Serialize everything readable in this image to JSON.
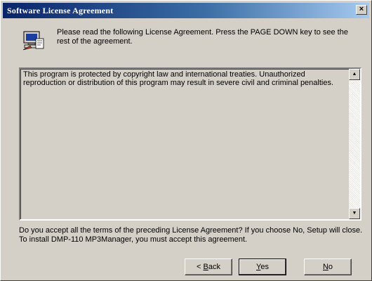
{
  "window": {
    "title": "Software License Agreement",
    "close_glyph": "×"
  },
  "header": {
    "icon": "setup-computer-icon",
    "instruction": "Please read the following License Agreement. Press the PAGE DOWN key to see the rest of the agreement."
  },
  "license": {
    "text": "This program is protected by copyright law and international treaties. Unauthorized reproduction or distribution of this program may result in severe civil and criminal penalties.",
    "scroll_up_glyph": "▲",
    "scroll_down_glyph": "▼"
  },
  "question": "Do you accept all the terms of the preceding License Agreement? If you choose No, Setup will close. To install DMP-110 MP3Manager, you must accept this agreement.",
  "buttons": {
    "back_prefix": "< ",
    "back_mnemonic": "B",
    "back_rest": "ack",
    "yes_mnemonic": "Y",
    "yes_rest": "es",
    "no_mnemonic": "N",
    "no_rest": "o"
  },
  "colors": {
    "title_gradient_start": "#0a246a",
    "title_gradient_end": "#a6caf0",
    "face": "#d4d0c8"
  }
}
